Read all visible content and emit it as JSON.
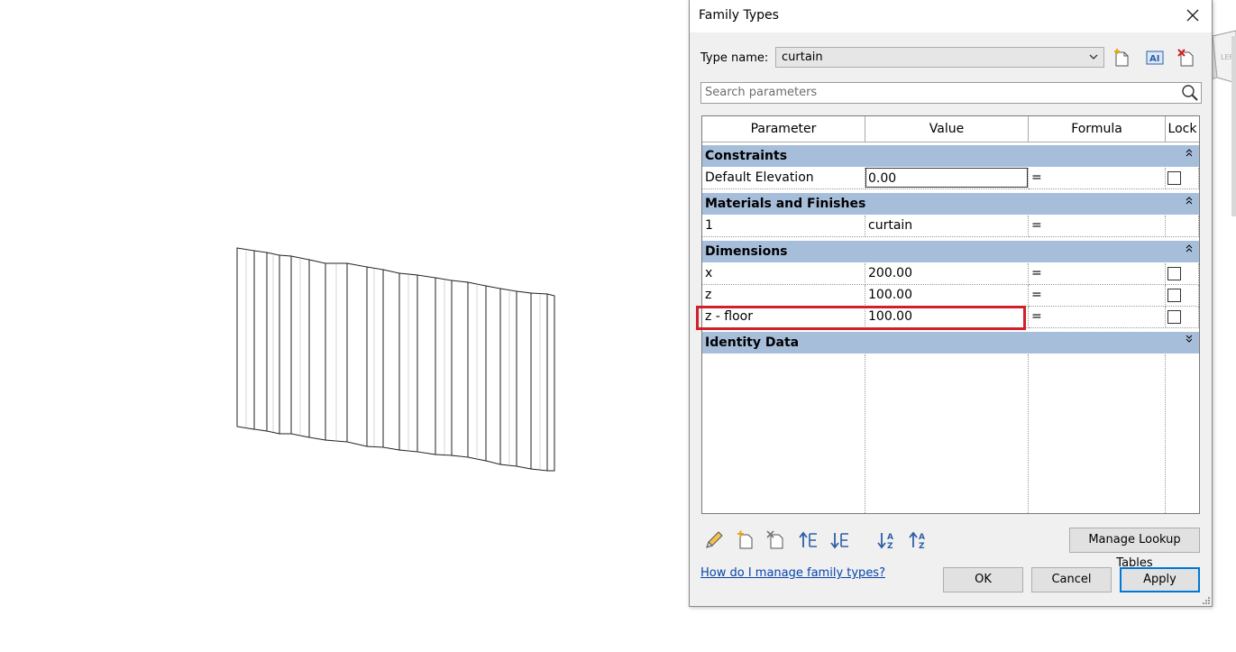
{
  "dialog": {
    "title": "Family Types",
    "type_name_label": "Type name:",
    "type_name_value": "curtain",
    "search_placeholder": "Search parameters"
  },
  "grid": {
    "headers": {
      "parameter": "Parameter",
      "value": "Value",
      "formula": "Formula",
      "lock": "Lock"
    },
    "groups": {
      "constraints": {
        "label": "Constraints",
        "rows": [
          {
            "param": "Default Elevation",
            "value": "0.00",
            "formula": "="
          }
        ]
      },
      "materials": {
        "label": "Materials and Finishes",
        "rows": [
          {
            "param": "1",
            "value": "curtain",
            "formula": "="
          }
        ]
      },
      "dimensions": {
        "label": "Dimensions",
        "rows": [
          {
            "param": "x",
            "value": "200.00",
            "formula": "="
          },
          {
            "param": "z",
            "value": "100.00",
            "formula": "="
          },
          {
            "param": "z - floor",
            "value": "100.00",
            "formula": "="
          }
        ]
      },
      "identity": {
        "label": "Identity Data"
      }
    }
  },
  "footer": {
    "manage_lookup_label": "Manage Lookup Tables",
    "help_link": "How do I manage family types?",
    "ok_label": "OK",
    "cancel_label": "Cancel",
    "apply_label": "Apply"
  },
  "icons": {
    "toolbar": [
      "new-type-icon",
      "rename-type-icon",
      "delete-type-icon"
    ],
    "bottom": [
      "edit-parameter-icon",
      "new-parameter-icon",
      "delete-parameter-icon",
      "move-up-icon",
      "move-down-icon",
      "sort-ascending-icon",
      "sort-descending-icon"
    ]
  },
  "colors": {
    "group_header": "#a7bedb",
    "highlight": "#d0202a",
    "link": "#0645ad",
    "apply_border": "#0078d7"
  }
}
